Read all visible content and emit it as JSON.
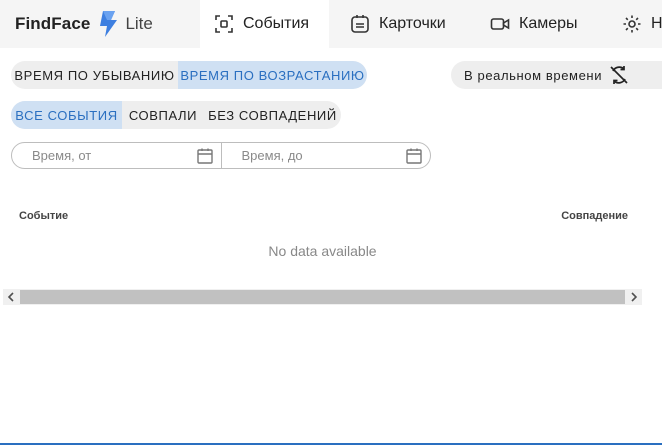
{
  "logo": {
    "name": "FindFace",
    "suffix": "Lite"
  },
  "nav": {
    "tabs": [
      {
        "label": "События",
        "icon": "events-icon",
        "active": true
      },
      {
        "label": "Карточки",
        "icon": "cards-icon",
        "active": false
      },
      {
        "label": "Камеры",
        "icon": "camera-icon",
        "active": false
      },
      {
        "label": "Н",
        "icon": "gear-icon",
        "active": false
      }
    ]
  },
  "sort": {
    "desc_label": "Время по убыванию",
    "asc_label": "Время по возрастанию",
    "selected": "asc"
  },
  "realtime": {
    "label": "В реальном времени",
    "icon": "sync-off-icon"
  },
  "filters": {
    "all_label": "Все события",
    "matched_label": "Совпали",
    "unmatched_label": "Без совпадений",
    "selected": "all"
  },
  "date_range": {
    "from_placeholder": "Время, от",
    "to_placeholder": "Время, до"
  },
  "table": {
    "columns": [
      "Событие",
      "Совпадение"
    ],
    "empty_text": "No data available"
  },
  "colors": {
    "accent": "#2a6fc0",
    "selected_chip": "#cfe0f3",
    "logo_blue": "#3d7fe0"
  }
}
